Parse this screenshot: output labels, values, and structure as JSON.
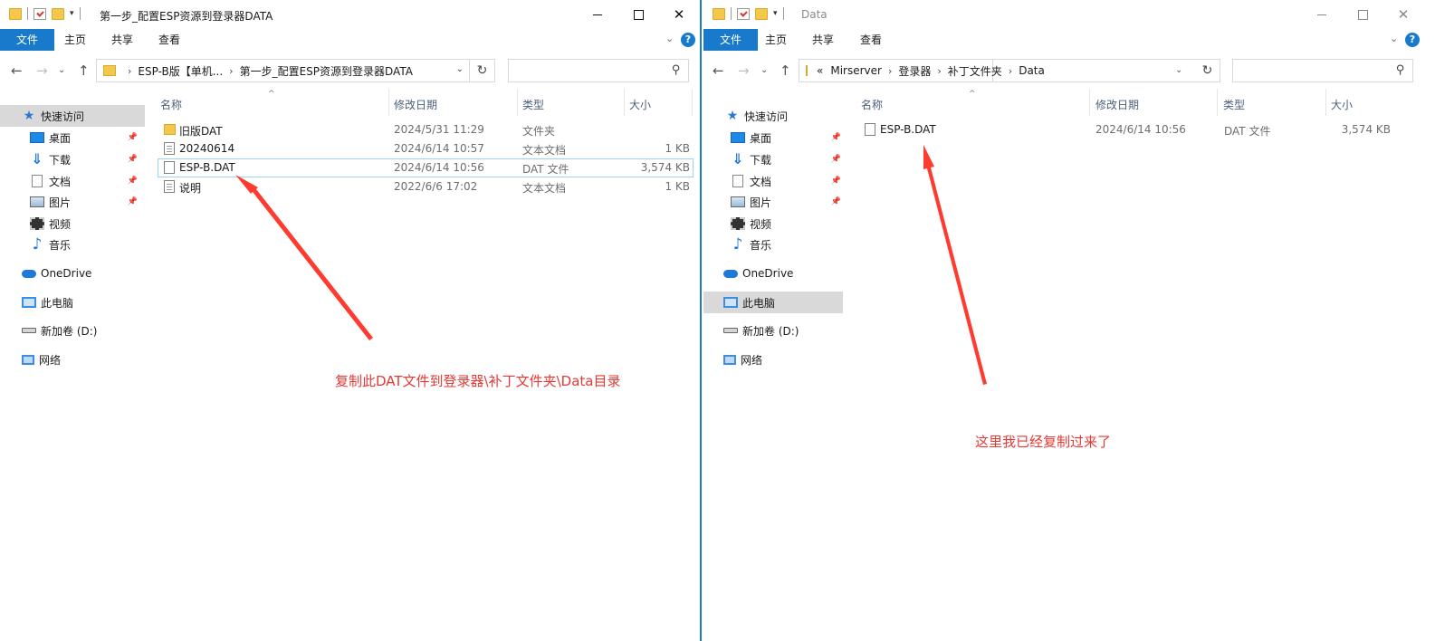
{
  "left": {
    "title": "第一步_配置ESP资源到登录器DATA",
    "ribbon_tabs": [
      "文件",
      "主页",
      "共享",
      "查看"
    ],
    "address": [
      "ESP-B版【单机...",
      "第一步_配置ESP资源到登录器DATA"
    ],
    "columns": [
      "名称",
      "修改日期",
      "类型",
      "大小"
    ],
    "files": [
      {
        "name": "旧版DAT",
        "date": "2024/5/31 11:29",
        "type": "文件夹",
        "size": "",
        "icon": "folder-icon"
      },
      {
        "name": "20240614",
        "date": "2024/6/14 10:57",
        "type": "文本文档",
        "size": "1 KB",
        "icon": "text-file-icon"
      },
      {
        "name": "ESP-B.DAT",
        "date": "2024/6/14 10:56",
        "type": "DAT 文件",
        "size": "3,574 KB",
        "icon": "file-icon"
      },
      {
        "name": "说明",
        "date": "2022/6/6 17:02",
        "type": "文本文档",
        "size": "1 KB",
        "icon": "text-file-icon"
      }
    ],
    "annotation": "复制此DAT文件到登录器\\补丁文件夹\\Data目录"
  },
  "right": {
    "title": "Data",
    "ribbon_tabs": [
      "文件",
      "主页",
      "共享",
      "查看"
    ],
    "address_prefix": "«",
    "address": [
      "Mirserver",
      "登录器",
      "补丁文件夹",
      "Data"
    ],
    "columns": [
      "名称",
      "修改日期",
      "类型",
      "大小"
    ],
    "files": [
      {
        "name": "ESP-B.DAT",
        "date": "2024/6/14 10:56",
        "type": "DAT 文件",
        "size": "3,574 KB",
        "icon": "file-icon"
      }
    ],
    "annotation": "这里我已经复制过来了"
  },
  "nav": {
    "quick_access": "快速访问",
    "desktop": "桌面",
    "downloads": "下载",
    "documents": "文档",
    "pictures": "图片",
    "videos": "视频",
    "music": "音乐",
    "onedrive": "OneDrive",
    "this_pc": "此电脑",
    "drive_d": "新加卷 (D:)",
    "network": "网络"
  },
  "colors": {
    "accent": "#1979ca",
    "annotation": "#e53935"
  }
}
